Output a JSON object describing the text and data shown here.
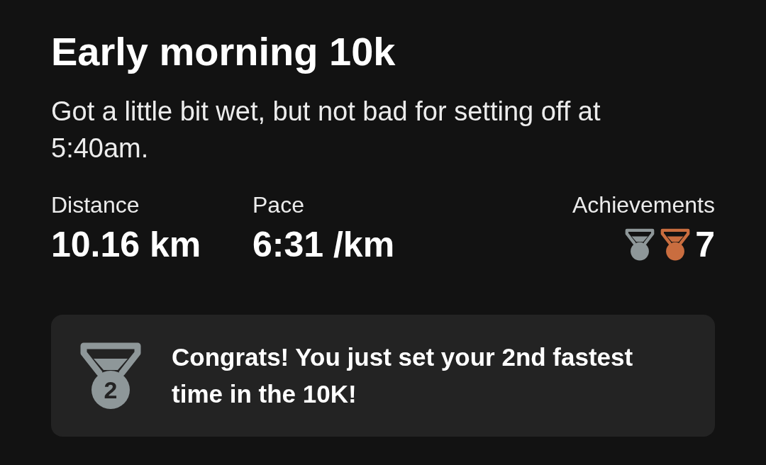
{
  "activity": {
    "title": "Early morning 10k",
    "description": "Got a little bit wet, but not bad for setting off at 5:40am."
  },
  "stats": [
    {
      "label": "Distance",
      "value": "10.16 km"
    },
    {
      "label": "Pace",
      "value": "6:31 /km"
    }
  ],
  "achievements": {
    "label": "Achievements",
    "medals": [
      {
        "color": "#8e9799"
      },
      {
        "color": "#c96d3f"
      }
    ],
    "count": "7"
  },
  "notice": {
    "medal_rank": "2",
    "message": "Congrats! You just set your 2nd fastest time in the 10K!"
  }
}
